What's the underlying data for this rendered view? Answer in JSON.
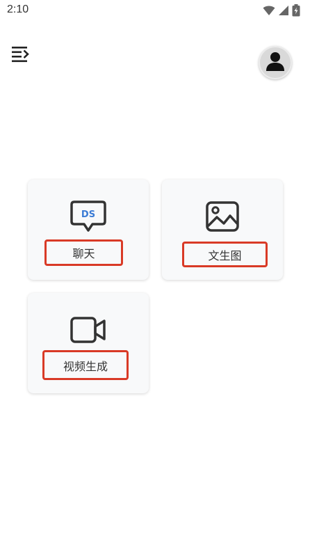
{
  "status_bar": {
    "time": "2:10",
    "icons": [
      "wifi-icon",
      "signal-icon",
      "battery-charging-icon"
    ]
  },
  "header": {
    "menu_icon": "menu-collapse-icon",
    "avatar_icon": "person-icon"
  },
  "cards": [
    {
      "label": "聊天",
      "icon": "ds-chat-bubble-icon",
      "icon_text": "DS",
      "accent_color": "#3a7bd5"
    },
    {
      "label": "文生图",
      "icon": "image-icon"
    },
    {
      "label": "视频生成",
      "icon": "video-camera-icon"
    }
  ],
  "colors": {
    "highlight_border": "#d93a26",
    "icon_dark": "#333333",
    "card_background": "#f8f9fa"
  }
}
